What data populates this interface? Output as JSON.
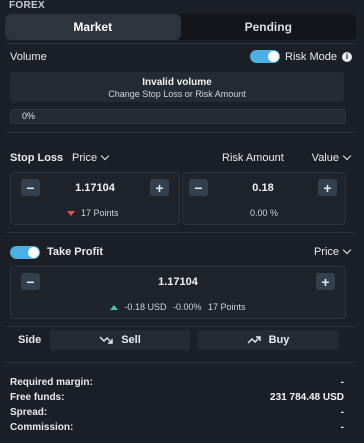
{
  "header": {
    "title": "FOREX"
  },
  "tabs": [
    {
      "label": "Market"
    },
    {
      "label": "Pending"
    }
  ],
  "volume": {
    "label": "Volume",
    "risk_mode_label": "Risk Mode",
    "risk_mode_on": true
  },
  "alert": {
    "title": "Invalid volume",
    "subtitle": "Change Stop Loss or Risk Amount"
  },
  "progress": {
    "label": "0%",
    "value": 0
  },
  "stop_loss": {
    "label": "Stop Loss",
    "mode": "Price",
    "value": "1.17104",
    "points": "17 Points"
  },
  "risk_amount": {
    "label": "Risk Amount",
    "mode": "Value",
    "value": "0.18",
    "percent": "0.00 %"
  },
  "take_profit": {
    "label": "Take Profit",
    "enabled": true,
    "mode": "Price",
    "value": "1.17104",
    "usd": "-0.18 USD",
    "percent": "-0.00%",
    "points": "17 Points"
  },
  "side": {
    "label": "Side",
    "sell": "Sell",
    "buy": "Buy"
  },
  "summary": {
    "required_margin_label": "Required margin:",
    "required_margin_value": "-",
    "free_funds_label": "Free funds:",
    "free_funds_value": "231 784.48 USD",
    "spread_label": "Spread:",
    "spread_value": "-",
    "commission_label": "Commission:",
    "commission_value": "-"
  },
  "colors": {
    "accent": "#4ab0e5",
    "loss": "#e4505a",
    "gain": "#4ac4a8"
  },
  "icons": {
    "minus": "minus-icon",
    "plus": "plus-icon",
    "sell": "trend-down-icon",
    "buy": "trend-up-icon",
    "info": "info-icon"
  }
}
